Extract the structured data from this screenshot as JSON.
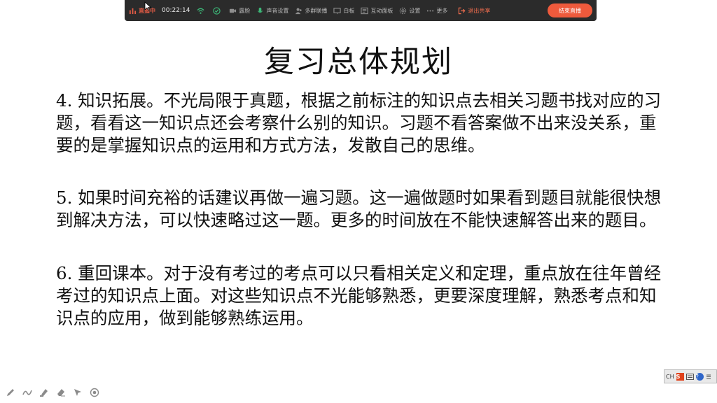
{
  "toolbar": {
    "live_status": "直播中",
    "timer": "00:22:14",
    "face": "露脸",
    "sound_settings": "声音设置",
    "multi_link": "多群联播",
    "whiteboard": "白板",
    "interactive_panel": "互动面板",
    "settings": "设置",
    "more": "更多",
    "exit_share": "退出共享",
    "end_live": "结束直播",
    "colors": {
      "accent": "#ef5a3c",
      "background": "#2b2b2b"
    }
  },
  "slide": {
    "title": "复习总体规划",
    "paragraphs": [
      "4. 知识拓展。不光局限于真题，根据之前标注的知识点去相关习题书找对应的习题，看看这一知识点还会考察什么别的知识。习题不看答案做不出来没关系，重要的是掌握知识点的运用和方式方法，发散自己的思维。",
      "5. 如果时间充裕的话建议再做一遍习题。这一遍做题时如果看到题目就能很快想到解决方法，可以快速略过这一题。更多的时间放在不能快速解答出来的题目。",
      "6. 重回课本。对于没有考过的考点可以只看相关定义和定理，重点放在往年曾经考过的知识点上面。对这些知识点不光能够熟悉，更要深度理解，熟悉考点和知识点的应用，做到能够熟练运用。"
    ]
  },
  "pen_tools": [
    "pen-icon",
    "curve-icon",
    "highlighter-icon",
    "eraser-icon",
    "pointer-icon",
    "laser-icon"
  ],
  "ime": {
    "lang": "CH",
    "brand": "S",
    "help": "?"
  }
}
